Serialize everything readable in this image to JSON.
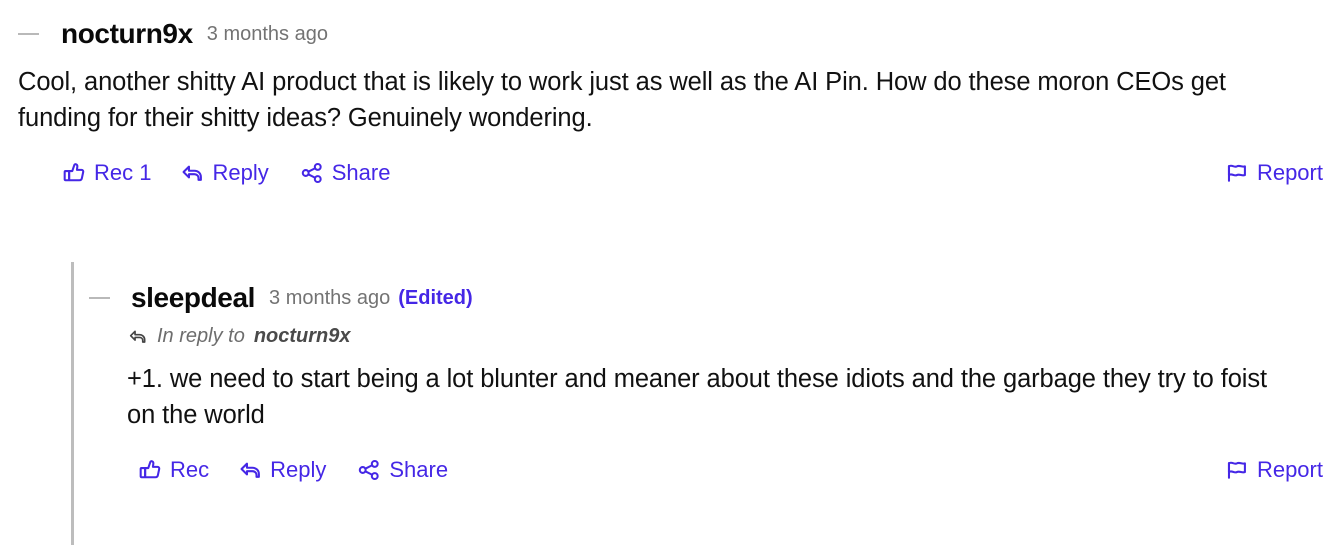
{
  "comment": {
    "collapse_icon": "collapse-dash-icon",
    "author": "nocturn9x",
    "timestamp": "3 months ago",
    "body": "Cool, another shitty AI product that is likely to work just as well as the AI Pin. How do these moron CEOs get funding for their shitty ideas? Genuinely wondering.",
    "actions": {
      "rec": {
        "icon": "thumbs-up-icon",
        "label": "Rec 1"
      },
      "reply": {
        "icon": "reply-arrow-icon",
        "label": "Reply"
      },
      "share": {
        "icon": "share-nodes-icon",
        "label": "Share"
      },
      "report": {
        "icon": "flag-icon",
        "label": "Report"
      }
    }
  },
  "reply": {
    "collapse_icon": "collapse-dash-icon",
    "author": "sleepdeal",
    "timestamp": "3 months ago",
    "edited_label": "(Edited)",
    "in_reply_to": {
      "icon": "reply-arrow-icon",
      "prefix": "In reply to",
      "target": "nocturn9x"
    },
    "body": "+1. we need to start being a lot blunter and meaner about these idiots and the garbage they try to foist on the world",
    "actions": {
      "rec": {
        "icon": "thumbs-up-icon",
        "label": "Rec"
      },
      "reply": {
        "icon": "reply-arrow-icon",
        "label": "Reply"
      },
      "share": {
        "icon": "share-nodes-icon",
        "label": "Share"
      },
      "report": {
        "icon": "flag-icon",
        "label": "Report"
      }
    }
  },
  "colors": {
    "accent": "#4527e6",
    "text": "#111111",
    "muted": "#737373",
    "thread_line": "#bdbdbd",
    "collapse_dash": "#b9b9b9"
  }
}
